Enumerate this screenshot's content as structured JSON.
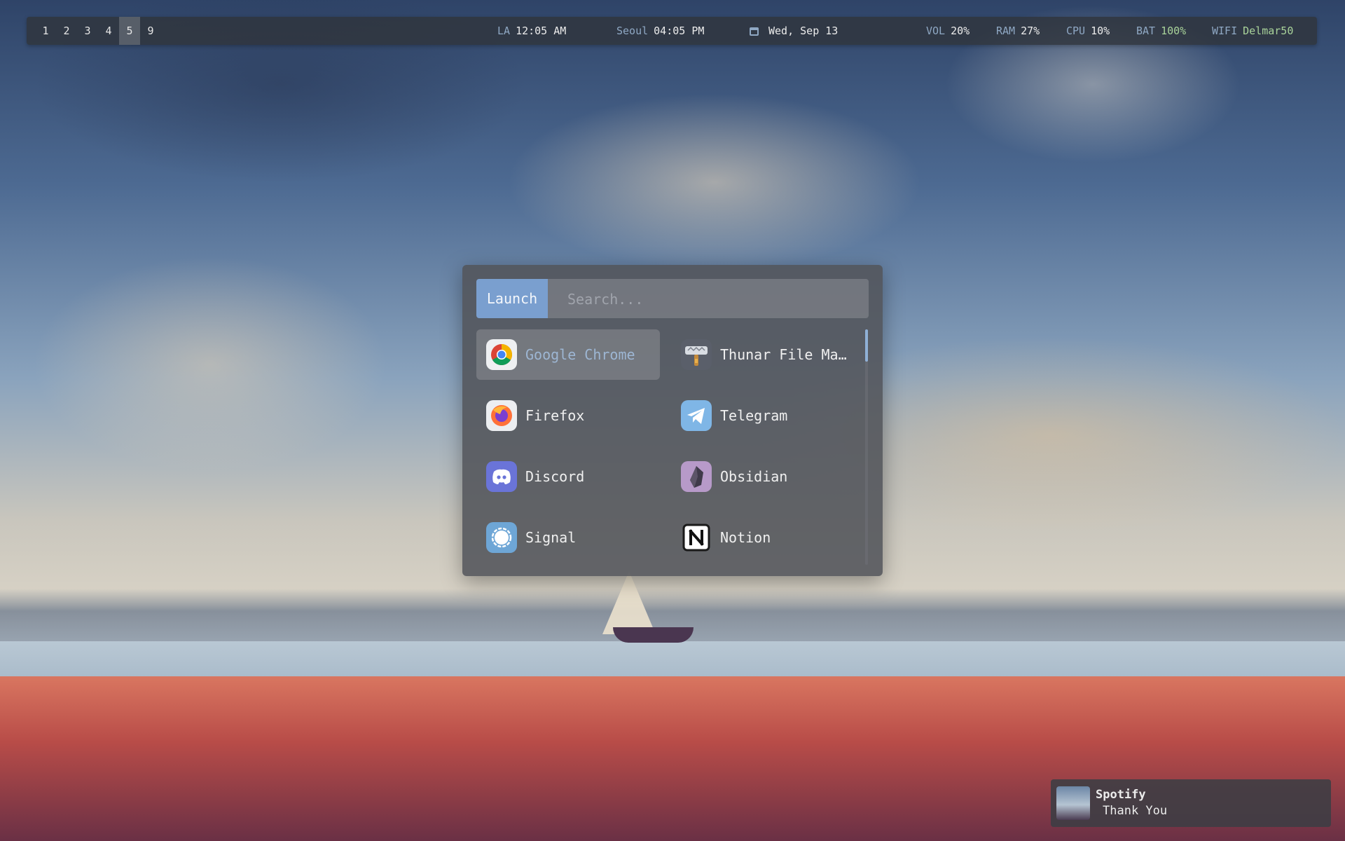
{
  "topbar": {
    "workspaces": [
      "1",
      "2",
      "3",
      "4",
      "5",
      "9"
    ],
    "active_workspace": "5",
    "clock_la": {
      "key": "LA",
      "value": "12:05 AM"
    },
    "clock_seoul": {
      "key": "Seoul",
      "value": "04:05 PM"
    },
    "date": "Wed, Sep 13",
    "vol": {
      "key": "VOL",
      "value": "20%"
    },
    "ram": {
      "key": "RAM",
      "value": "27%"
    },
    "cpu": {
      "key": "CPU",
      "value": "10%"
    },
    "bat": {
      "key": "BAT",
      "value": "100%"
    },
    "wifi": {
      "key": "WIFI",
      "value": "Delmar50"
    }
  },
  "launcher": {
    "label": "Launch",
    "search_placeholder": "Search...",
    "apps": [
      {
        "name": "Google Chrome",
        "icon": "chrome-icon",
        "selected": true
      },
      {
        "name": "Thunar File Ma…",
        "icon": "thunar-icon"
      },
      {
        "name": "Firefox",
        "icon": "firefox-icon"
      },
      {
        "name": "Telegram",
        "icon": "telegram-icon"
      },
      {
        "name": "Discord",
        "icon": "discord-icon"
      },
      {
        "name": "Obsidian",
        "icon": "obsidian-icon"
      },
      {
        "name": "Signal",
        "icon": "signal-icon"
      },
      {
        "name": "Notion",
        "icon": "notion-icon"
      }
    ]
  },
  "notification": {
    "title": "Spotify",
    "body": "Thank You"
  },
  "colors": {
    "accent": "#7a9fcf",
    "green": "#a9d39a",
    "bar_key": "#8fa8c4"
  }
}
